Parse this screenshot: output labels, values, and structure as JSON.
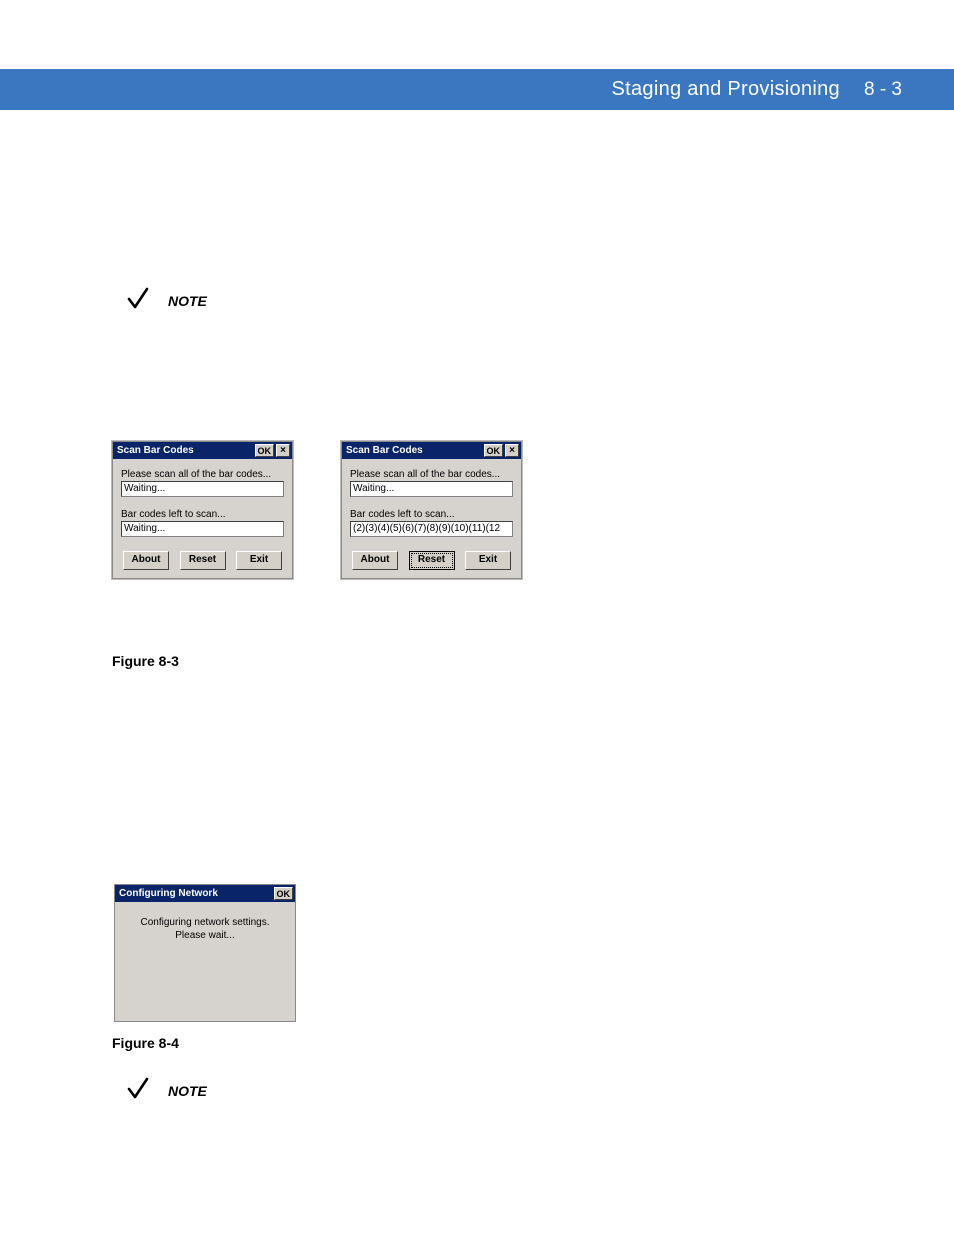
{
  "header": {
    "title": "Staging and Provisioning",
    "page": "8 - 3"
  },
  "note1": {
    "label": "NOTE"
  },
  "scanDialogA": {
    "title": "Scan Bar Codes",
    "ok": "OK",
    "close": "×",
    "prompt": "Please scan all of the bar codes...",
    "field1": "Waiting...",
    "leftLabel": "Bar codes left to scan...",
    "field2": "Waiting...",
    "btnAbout": "About",
    "btnReset": "Reset",
    "btnExit": "Exit"
  },
  "scanDialogB": {
    "title": "Scan Bar Codes",
    "ok": "OK",
    "close": "×",
    "prompt": "Please scan all of the bar codes...",
    "field1": "Waiting...",
    "leftLabel": "Bar codes left to scan...",
    "field2": "(2)(3)(4)(5)(6)(7)(8)(9)(10)(11)(12",
    "btnAbout": "About",
    "btnReset": "Reset",
    "btnExit": "Exit"
  },
  "figure3": {
    "caption": "Figure 8-3"
  },
  "configDialog": {
    "title": "Configuring Network",
    "ok": "OK",
    "body": "Configuring network settings.  Please wait..."
  },
  "figure4": {
    "caption": "Figure 8-4"
  },
  "note2": {
    "label": "NOTE"
  }
}
